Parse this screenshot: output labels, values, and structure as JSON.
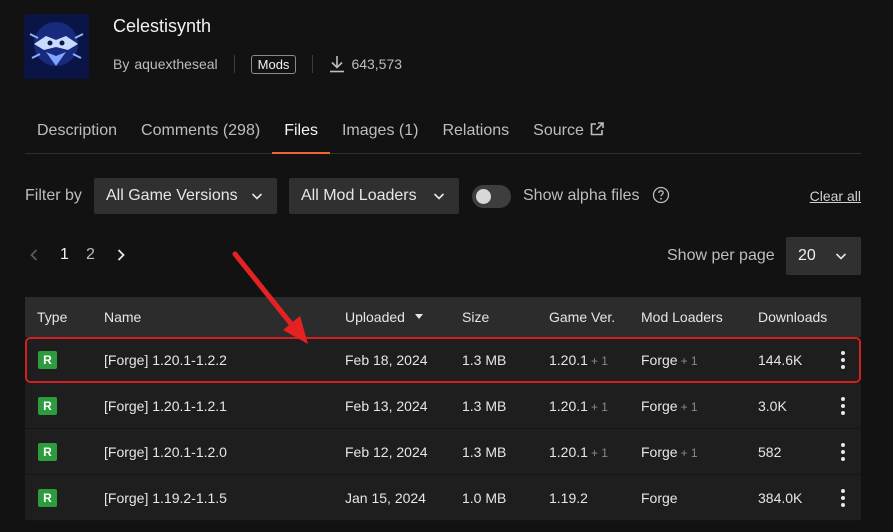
{
  "project": {
    "title": "Celestisynth",
    "by_label": "By",
    "author": "aquextheseal",
    "category": "Mods",
    "downloads": "643,573"
  },
  "tabs": [
    {
      "label": "Description"
    },
    {
      "label": "Comments (298)"
    },
    {
      "label": "Files",
      "active": true
    },
    {
      "label": "Images (1)"
    },
    {
      "label": "Relations"
    },
    {
      "label": "Source"
    }
  ],
  "filters": {
    "label": "Filter by",
    "game_versions": "All Game Versions",
    "mod_loaders": "All Mod Loaders",
    "show_alpha_label": "Show alpha files",
    "show_alpha_enabled": false,
    "clear_all": "Clear all"
  },
  "pagination": {
    "pages": [
      "1",
      "2"
    ],
    "current": "1",
    "per_page_label": "Show per page",
    "per_page": "20"
  },
  "table": {
    "headers": {
      "type": "Type",
      "name": "Name",
      "uploaded": "Uploaded",
      "size": "Size",
      "game_ver": "Game Ver.",
      "mod_loaders": "Mod Loaders",
      "downloads": "Downloads"
    },
    "rows": [
      {
        "type": "R",
        "name": "[Forge] 1.20.1-1.2.2",
        "uploaded": "Feb 18, 2024",
        "size": "1.3 MB",
        "game_ver": "1.20.1",
        "game_ver_extra": "+ 1",
        "loader": "Forge",
        "loader_extra": "+ 1",
        "downloads": "144.6K"
      },
      {
        "type": "R",
        "name": "[Forge] 1.20.1-1.2.1",
        "uploaded": "Feb 13, 2024",
        "size": "1.3 MB",
        "game_ver": "1.20.1",
        "game_ver_extra": "+ 1",
        "loader": "Forge",
        "loader_extra": "+ 1",
        "downloads": "3.0K"
      },
      {
        "type": "R",
        "name": "[Forge] 1.20.1-1.2.0",
        "uploaded": "Feb 12, 2024",
        "size": "1.3 MB",
        "game_ver": "1.20.1",
        "game_ver_extra": "+ 1",
        "loader": "Forge",
        "loader_extra": "+ 1",
        "downloads": "582"
      },
      {
        "type": "R",
        "name": "[Forge] 1.19.2-1.1.5",
        "uploaded": "Jan 15, 2024",
        "size": "1.0 MB",
        "game_ver": "1.19.2",
        "game_ver_extra": "",
        "loader": "Forge",
        "loader_extra": "",
        "downloads": "384.0K"
      }
    ]
  },
  "colors": {
    "accent": "#f16436",
    "release_badge": "#2e9b3f",
    "highlight_outline": "#d21f1f",
    "annotation_arrow": "#e52222"
  },
  "icons": {
    "download": "download-icon",
    "external": "external-link-icon",
    "help": "help-circle-icon",
    "chevron": "chevron-down-icon",
    "menu": "kebab-menu-icon"
  }
}
